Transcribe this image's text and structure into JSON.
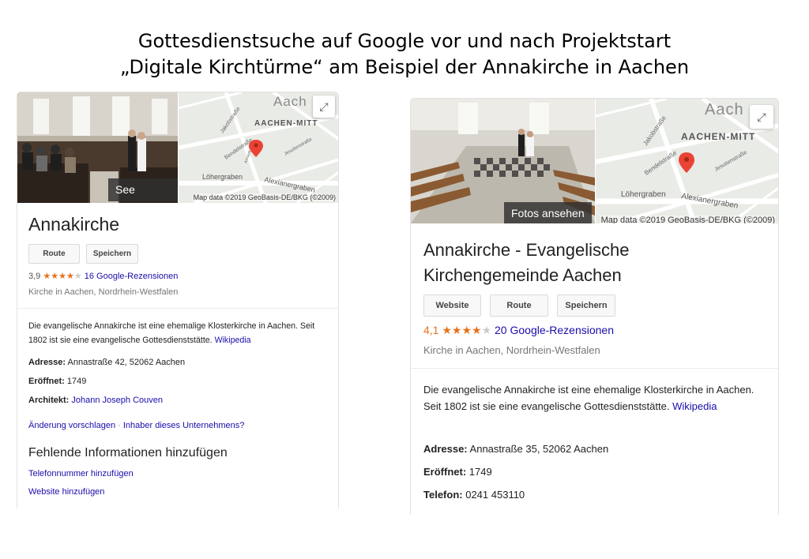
{
  "page": {
    "title_line1": "Gottesdienstsuche auf Google vor und nach Projektstart",
    "title_line2": "„Digitale Kirchtürme“ am Beispiel der Annakirche in Aachen"
  },
  "before": {
    "photo_button": "See photos",
    "map": {
      "labels": [
        "Aach",
        "AACHEN-MITT",
        "Jakobstraße",
        "Bendelstraße",
        "Jesuitenstraße",
        "Löhergraben",
        "Alexianergraben",
        "Annastr."
      ],
      "attribution": "Map data ©2019 GeoBasis-DE/BKG (©2009)"
    },
    "title": "Annakirche",
    "buttons": [
      "Route",
      "Speichern"
    ],
    "rating": "3,9",
    "stars_filled": 4,
    "stars_total": 5,
    "reviews": "16 Google-Rezensionen",
    "category": "Kirche in Aachen, Nordrhein-Westfalen",
    "description": "Die evangelische Annakirche ist eine ehemalige Klosterkirche in Aachen. Seit 1802 ist sie eine evangelische Gottesdienststätte.",
    "wiki": "Wikipedia",
    "address_label": "Adresse:",
    "address": "Annastraße 42, 52062 Aachen",
    "opened_label": "Eröffnet:",
    "opened": "1749",
    "architect_label": "Architekt:",
    "architect": "Johann Joseph Couven",
    "suggest_edit": "Änderung vorschlagen",
    "separator": "·",
    "owner": "Inhaber dieses Unternehmens?",
    "missing_heading": "Fehlende Informationen hinzufügen",
    "add_phone": "Telefonnummer hinzufügen",
    "add_website": "Website hinzufügen"
  },
  "after": {
    "photo_button": "Fotos ansehen",
    "map": {
      "labels": [
        "Aach",
        "AACHEN-MITT",
        "Jakobstraße",
        "Bendelstraße",
        "Jesuitenstraße",
        "Löhergraben",
        "Alexianergraben"
      ],
      "attribution": "Map data ©2019 GeoBasis-DE/BKG (©2009)"
    },
    "title": "Annakirche - Evangelische Kirchengemeinde Aachen",
    "buttons": [
      "Website",
      "Route",
      "Speichern"
    ],
    "rating": "4,1",
    "stars_filled": 4,
    "stars_total": 5,
    "reviews": "20 Google-Rezensionen",
    "category": "Kirche in Aachen, Nordrhein-Westfalen",
    "description": "Die evangelische Annakirche ist eine ehemalige Klosterkirche in Aachen. Seit 1802 ist sie eine evangelische Gottesdienststätte.",
    "wiki": "Wikipedia",
    "address_label": "Adresse:",
    "address": "Annastraße 35, 52062 Aachen",
    "opened_label": "Eröffnet:",
    "opened": "1749",
    "phone_label": "Telefon:",
    "phone": "0241 453110"
  },
  "colors": {
    "link": "#1a0dab",
    "star": "#e7711b",
    "pin": "#ea4335",
    "map_bg": "#e8ebe7"
  },
  "icons": [
    "expand-icon",
    "map-pin-icon",
    "star-icon"
  ]
}
